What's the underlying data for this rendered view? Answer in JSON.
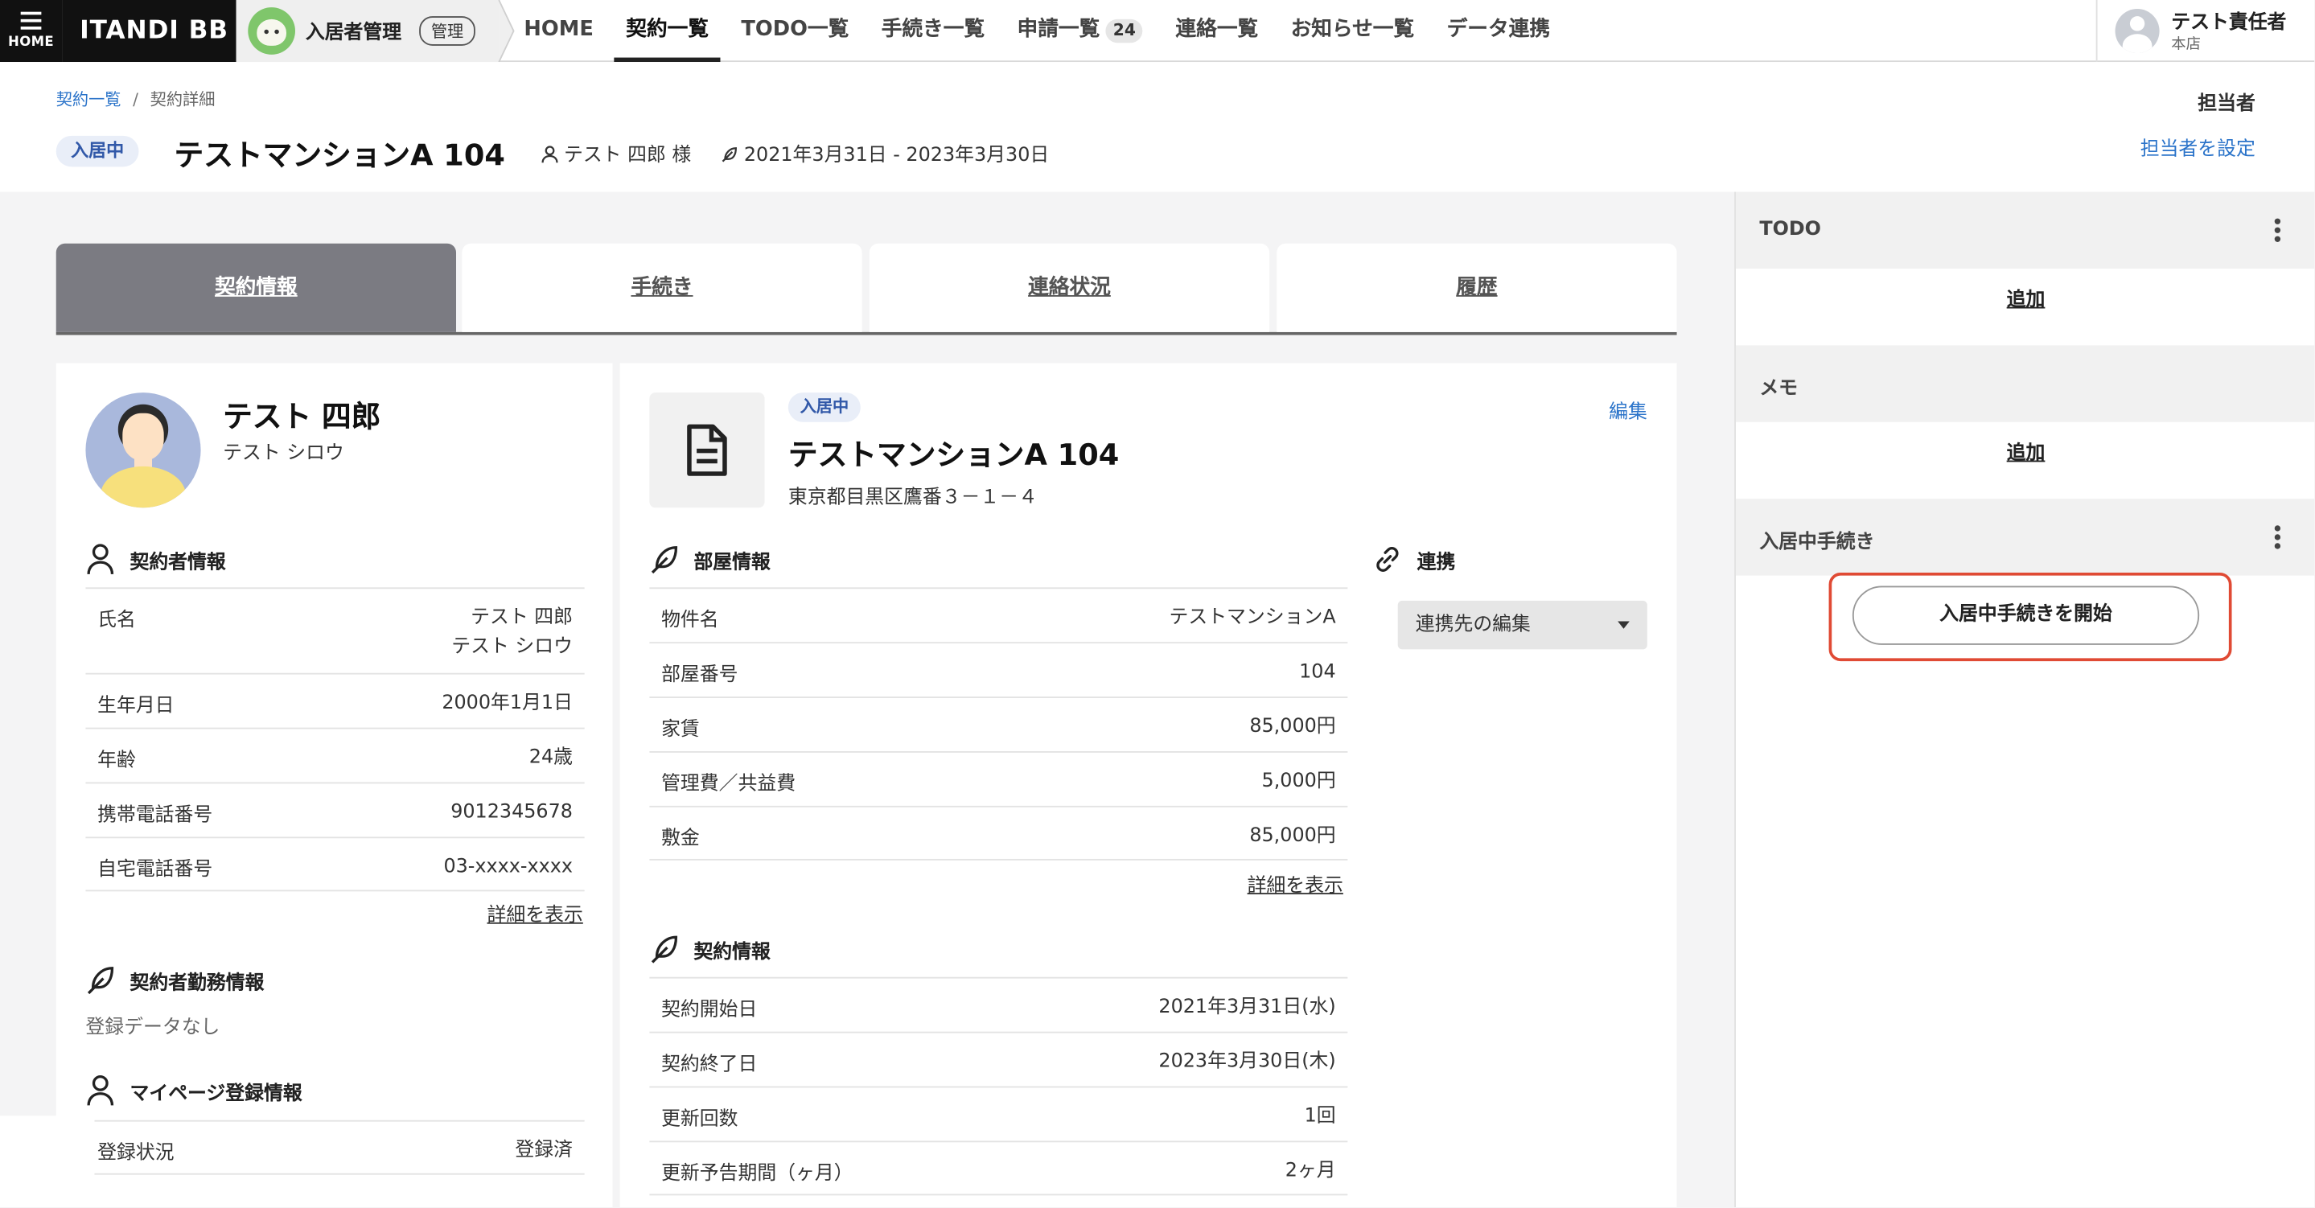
{
  "nav": {
    "home_label": "HOME",
    "brand": "ITANDI BB",
    "product_name": "入居者管理",
    "product_badge": "管理",
    "items": [
      {
        "label": "HOME"
      },
      {
        "label": "契約一覧",
        "active": true
      },
      {
        "label": "TODO一覧"
      },
      {
        "label": "手続き一覧"
      },
      {
        "label": "申請一覧",
        "badge": "24"
      },
      {
        "label": "連絡一覧"
      },
      {
        "label": "お知らせ一覧"
      },
      {
        "label": "データ連携"
      }
    ],
    "user_name": "テスト責任者",
    "user_branch": "本店"
  },
  "header": {
    "breadcrumb": [
      "契約一覧",
      "契約詳細"
    ],
    "status": "入居中",
    "title": "テストマンションA 104",
    "tenant": "テスト 四郎 様",
    "period": "2021年3月31日 - 2023年3月30日",
    "owner_label": "担当者",
    "owner_link": "担当者を設定"
  },
  "tabs": [
    "契約情報",
    "手続き",
    "連絡状況",
    "履歴"
  ],
  "contractor": {
    "name": "テスト 四郎",
    "kana": "テスト シロウ",
    "section_title": "契約者情報",
    "rows": [
      {
        "k": "氏名",
        "v1": "テスト 四郎",
        "v2": "テスト シロウ"
      },
      {
        "k": "生年月日",
        "v1": "2000年1月1日"
      },
      {
        "k": "年齢",
        "v1": "24歳"
      },
      {
        "k": "携帯電話番号",
        "v1": "9012345678"
      },
      {
        "k": "自宅電話番号",
        "v1": "03-xxxx-xxxx"
      }
    ],
    "detail_link": "詳細を表示",
    "work_title": "契約者勤務情報",
    "work_nodata": "登録データなし",
    "mypage_title": "マイページ登録情報",
    "mypage_rows": [
      {
        "k": "登録状況",
        "v1": "登録済"
      }
    ]
  },
  "property": {
    "status": "入居中",
    "title": "テストマンションA 104",
    "address": "東京都目黒区鷹番３－１－４",
    "edit_link": "編集",
    "room_title": "部屋情報",
    "room_rows": [
      {
        "k": "物件名",
        "v1": "テストマンションA"
      },
      {
        "k": "部屋番号",
        "v1": "104"
      },
      {
        "k": "家賃",
        "v1": "85,000円"
      },
      {
        "k": "管理費／共益費",
        "v1": "5,000円"
      },
      {
        "k": "敷金",
        "v1": "85,000円"
      }
    ],
    "detail_link": "詳細を表示",
    "contract_title": "契約情報",
    "contract_rows": [
      {
        "k": "契約開始日",
        "v1": "2021年3月31日(水)"
      },
      {
        "k": "契約終了日",
        "v1": "2023年3月30日(木)"
      },
      {
        "k": "更新回数",
        "v1": "1回"
      },
      {
        "k": "更新予告期間（ヶ月）",
        "v1": "2ヶ月"
      }
    ],
    "link_title": "連携",
    "link_select": "連携先の編集"
  },
  "sidebar": {
    "todo_title": "TODO",
    "todo_add": "追加",
    "memo_title": "メモ",
    "memo_add": "追加",
    "proc_title": "入居中手続き",
    "proc_button": "入居中手続きを開始"
  }
}
